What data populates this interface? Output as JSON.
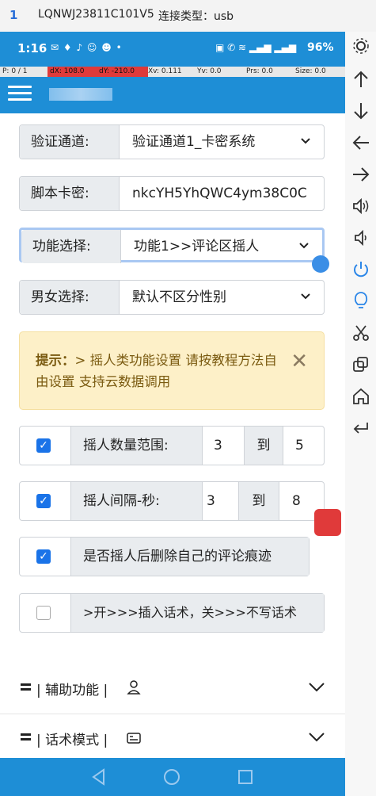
{
  "titlebar": {
    "index": "1",
    "device": "LQNWJ23811C101V5",
    "connection": "连接类型：usb"
  },
  "statusbar": {
    "time": "1:16",
    "battery": "96%"
  },
  "debug": {
    "p": "P: 0 / 1",
    "dx": "dX: 108.0",
    "dy": "dY: -210.0",
    "xv": "Xv: 0.111",
    "yv": "Yv: 0.0",
    "prs": "Prs: 0.0",
    "size": "Size: 0.0"
  },
  "form": {
    "channel": {
      "label": "验证通道:",
      "value": "验证通道1_卡密系统"
    },
    "key": {
      "label": "脚本卡密:",
      "value": "nkcYH5YhQWC4ym38C0C"
    },
    "function": {
      "label": "功能选择:",
      "value": "功能1>>评论区摇人"
    },
    "gender": {
      "label": "男女选择:",
      "value": "默认不区分性别"
    }
  },
  "alert": {
    "title": "提示：",
    "text": "> 摇人类功能设置 请按教程方法自由设置 支持云数据调用",
    "close": "✕"
  },
  "options": {
    "count": {
      "label": "摇人数量范围:",
      "from": "3",
      "to_label": "到",
      "to": "5",
      "checked": true
    },
    "interval": {
      "label": "摇人间隔-秒:",
      "from": "3",
      "to_label": "到",
      "to": "8",
      "checked": true
    },
    "delete": {
      "label": "是否摇人后删除自己的评论痕迹",
      "checked": true
    },
    "speech": {
      "label": ">开>>>插入话术，关>>>不写话术",
      "checked": false
    }
  },
  "sections": [
    {
      "label": "| 辅助功能 |",
      "icon": "user-icon"
    },
    {
      "label": "| 话术模式 |",
      "icon": "card-icon"
    }
  ],
  "colors": {
    "primary": "#1e8ed6",
    "accent": "#1a73e8",
    "alert_bg": "#fdf0c8"
  }
}
